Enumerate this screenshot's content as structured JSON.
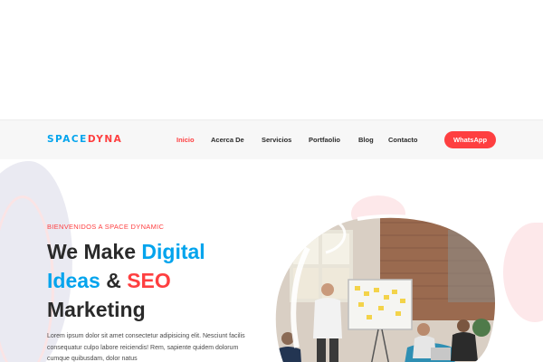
{
  "header": {
    "logo_part1": "SPACE",
    "logo_part2": "DYNA",
    "nav": [
      {
        "label": "Inicio",
        "active": true
      },
      {
        "label": "Acerca De",
        "active": false
      },
      {
        "label": "Servicios",
        "active": false
      },
      {
        "label": "Portfaolio",
        "active": false
      },
      {
        "label": "Blog",
        "active": false
      },
      {
        "label": "Contacto",
        "active": false
      }
    ],
    "cta_label": "WhatsApp"
  },
  "hero": {
    "eyebrow": "BIENVENIDOS A SPACE DYNAMIC",
    "title_we_make": "We Make ",
    "title_digital": "Digital",
    "title_ideas": "Ideas",
    "title_amp": " & ",
    "title_seo": "SEO",
    "title_marketing": "Marketing",
    "description": "Lorem ipsum dolor sit amet consectetur adipisicing elit. Nesciunt facilis consequatur culpo labore reiciendis! Rem, sapiente quidem dolorum cumque quibusdam, dolor natus"
  },
  "colors": {
    "blue": "#03a4ed",
    "red": "#fe3f40",
    "text": "#2a2a2a",
    "header_bg": "#f7f7f7"
  }
}
